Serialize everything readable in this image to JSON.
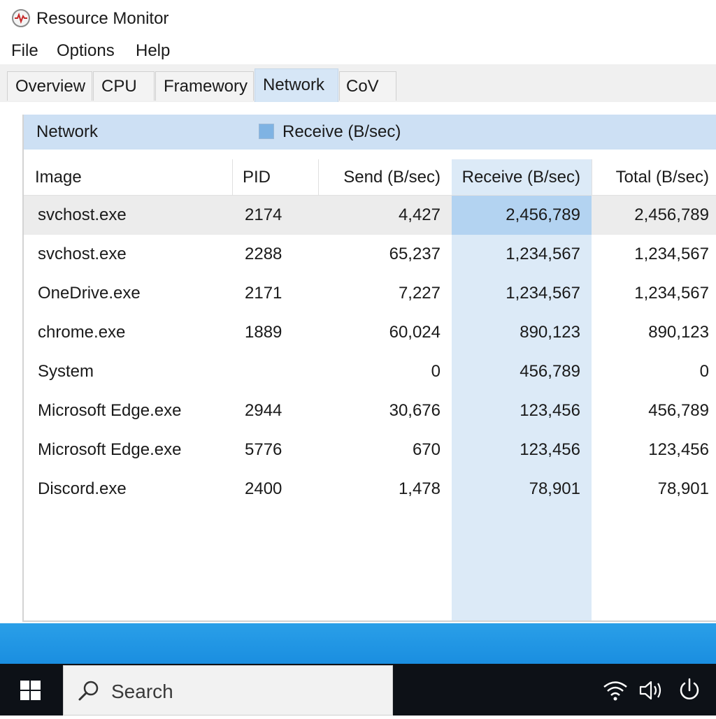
{
  "window": {
    "title": "Resource Monitor",
    "icon": "resource-monitor-gauge-icon"
  },
  "menu": {
    "items": [
      "File",
      "Options",
      "Help"
    ]
  },
  "tabs": {
    "items": [
      "Overview",
      "CPU",
      "Framewory",
      "Network",
      "CoV"
    ],
    "active": "Network"
  },
  "panel": {
    "title": "Network",
    "legend_label": "Receive (B/sec)",
    "legend_color": "#7fb3e3"
  },
  "table": {
    "headers": [
      "Image",
      "PID",
      "Send (B/sec)",
      "Receive (B/sec)",
      "Total (B/sec)"
    ],
    "sorted_column": "Receive (B/sec)",
    "rows": [
      {
        "image": "svchost.exe",
        "pid": "2174",
        "send": "4,427",
        "receive": "2,456,789",
        "total": "2,456,789",
        "selected": true
      },
      {
        "image": "svchost.exe",
        "pid": "2288",
        "send": "65,237",
        "receive": "1,234,567",
        "total": "1,234,567"
      },
      {
        "image": "OneDrive.exe",
        "pid": "2171",
        "send": "7,227",
        "receive": "1,234,567",
        "total": "1,234,567"
      },
      {
        "image": "chrome.exe",
        "pid": "1889",
        "send": "60,024",
        "receive": "890,123",
        "total": "890,123"
      },
      {
        "image": "System",
        "pid": "",
        "send": "0",
        "receive": "456,789",
        "total": "0"
      },
      {
        "image": "Microsoft Edge.exe",
        "pid": "2944",
        "send": "30,676",
        "receive": "123,456",
        "total": "456,789"
      },
      {
        "image": "Microsoft Edge.exe",
        "pid": "5776",
        "send": "670",
        "receive": "123,456",
        "total": "123,456"
      },
      {
        "image": "Discord.exe",
        "pid": "2400",
        "send": "1,478",
        "receive": "78,901",
        "total": "78,901"
      }
    ]
  },
  "taskbar": {
    "start_icon": "windows-logo-icon",
    "search_placeholder": "Search",
    "tray_icons": [
      "wifi-icon",
      "volume-icon",
      "power-icon"
    ]
  },
  "colors": {
    "panel_header": "#cde0f4",
    "sorted_column": "#dceaf7",
    "selected_cell": "#b3d3f1",
    "active_tab": "#d6e6f6",
    "desktop": "#1a8ee0",
    "taskbar": "#0d1117"
  }
}
